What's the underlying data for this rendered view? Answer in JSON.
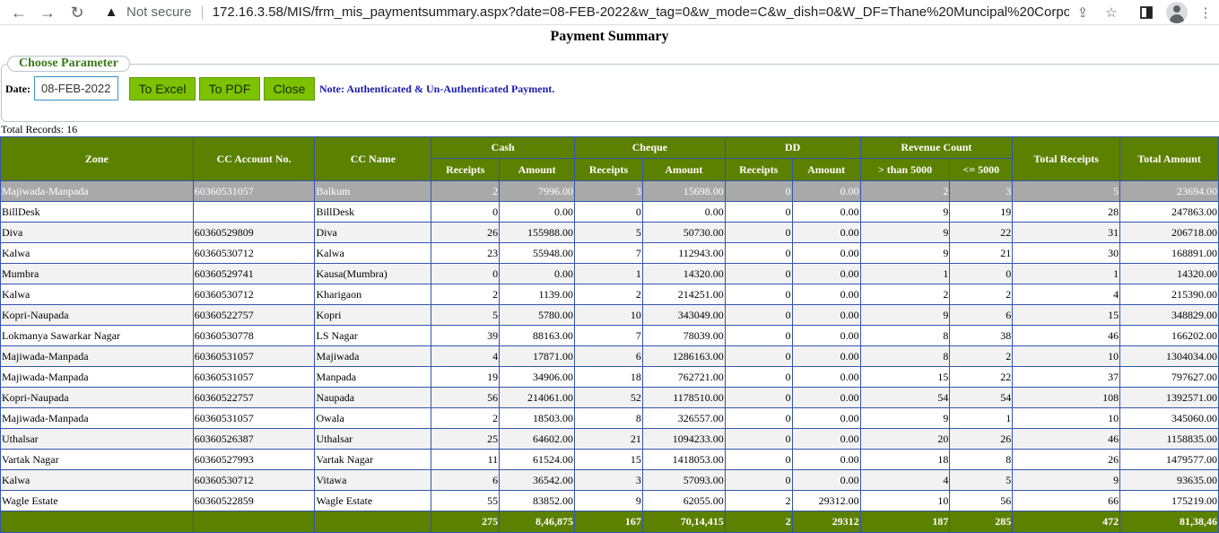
{
  "browser": {
    "security_label": "Not secure",
    "url": "172.16.3.58/MIS/frm_mis_paymentsummary.aspx?date=08-FEB-2022&w_tag=0&w_mode=C&w_dish=0&W_DF=Thane%20Muncipal%20Corporation%20(..."
  },
  "page": {
    "title": "Payment Summary",
    "fieldset_legend": "Choose Parameter",
    "date_label": "Date:",
    "date_value": "08-FEB-2022",
    "buttons": {
      "excel": "To Excel",
      "pdf": "To PDF",
      "close": "Close"
    },
    "note": "Note: Authenticated & Un-Authenticated Payment.",
    "total_records": "Total Records: 16"
  },
  "table": {
    "headers": {
      "zone": "Zone",
      "cc_account": "CC Account No.",
      "cc_name": "CC Name",
      "cash": "Cash",
      "cheque": "Cheque",
      "dd": "DD",
      "revenue_count": "Revenue Count",
      "total_receipts": "Total Receipts",
      "total_amount": "Total Amount",
      "receipts": "Receipts",
      "amount": "Amount",
      "gt5000": "> than 5000",
      "le5000": "<= 5000"
    },
    "rows": [
      [
        "Majiwada-Manpada",
        "60360531057",
        "Balkum",
        "2",
        "7996.00",
        "3",
        "15698.00",
        "0",
        "0.00",
        "2",
        "3",
        "5",
        "23694.00"
      ],
      [
        "BillDesk",
        "",
        "BillDesk",
        "0",
        "0.00",
        "0",
        "0.00",
        "0",
        "0.00",
        "9",
        "19",
        "28",
        "247863.00"
      ],
      [
        "Diva",
        "60360529809",
        "Diva",
        "26",
        "155988.00",
        "5",
        "50730.00",
        "0",
        "0.00",
        "9",
        "22",
        "31",
        "206718.00"
      ],
      [
        "Kalwa",
        "60360530712",
        "Kalwa",
        "23",
        "55948.00",
        "7",
        "112943.00",
        "0",
        "0.00",
        "9",
        "21",
        "30",
        "168891.00"
      ],
      [
        "Mumbra",
        "60360529741",
        "Kausa(Mumbra)",
        "0",
        "0.00",
        "1",
        "14320.00",
        "0",
        "0.00",
        "1",
        "0",
        "1",
        "14320.00"
      ],
      [
        "Kalwa",
        "60360530712",
        "Kharigaon",
        "2",
        "1139.00",
        "2",
        "214251.00",
        "0",
        "0.00",
        "2",
        "2",
        "4",
        "215390.00"
      ],
      [
        "Kopri-Naupada",
        "60360522757",
        "Kopri",
        "5",
        "5780.00",
        "10",
        "343049.00",
        "0",
        "0.00",
        "9",
        "6",
        "15",
        "348829.00"
      ],
      [
        "Lokmanya Sawarkar Nagar",
        "60360530778",
        "LS Nagar",
        "39",
        "88163.00",
        "7",
        "78039.00",
        "0",
        "0.00",
        "8",
        "38",
        "46",
        "166202.00"
      ],
      [
        "Majiwada-Manpada",
        "60360531057",
        "Majiwada",
        "4",
        "17871.00",
        "6",
        "1286163.00",
        "0",
        "0.00",
        "8",
        "2",
        "10",
        "1304034.00"
      ],
      [
        "Majiwada-Manpada",
        "60360531057",
        "Manpada",
        "19",
        "34906.00",
        "18",
        "762721.00",
        "0",
        "0.00",
        "15",
        "22",
        "37",
        "797627.00"
      ],
      [
        "Kopri-Naupada",
        "60360522757",
        "Naupada",
        "56",
        "214061.00",
        "52",
        "1178510.00",
        "0",
        "0.00",
        "54",
        "54",
        "108",
        "1392571.00"
      ],
      [
        "Majiwada-Manpada",
        "60360531057",
        "Owala",
        "2",
        "18503.00",
        "8",
        "326557.00",
        "0",
        "0.00",
        "9",
        "1",
        "10",
        "345060.00"
      ],
      [
        "Uthalsar",
        "60360526387",
        "Uthalsar",
        "25",
        "64602.00",
        "21",
        "1094233.00",
        "0",
        "0.00",
        "20",
        "26",
        "46",
        "1158835.00"
      ],
      [
        "Vartak Nagar",
        "60360527993",
        "Vartak Nagar",
        "11",
        "61524.00",
        "15",
        "1418053.00",
        "0",
        "0.00",
        "18",
        "8",
        "26",
        "1479577.00"
      ],
      [
        "Kalwa",
        "60360530712",
        "Vitawa",
        "6",
        "36542.00",
        "3",
        "57093.00",
        "0",
        "0.00",
        "4",
        "5",
        "9",
        "93635.00"
      ],
      [
        "Wagle Estate",
        "60360522859",
        "Wagle Estate",
        "55",
        "83852.00",
        "9",
        "62055.00",
        "2",
        "29312.00",
        "10",
        "56",
        "66",
        "175219.00"
      ]
    ],
    "footer": [
      "",
      "",
      "",
      "275",
      "8,46,875",
      "167",
      "70,14,415",
      "2",
      "29312",
      "187",
      "285",
      "472",
      "81,38,46"
    ]
  }
}
